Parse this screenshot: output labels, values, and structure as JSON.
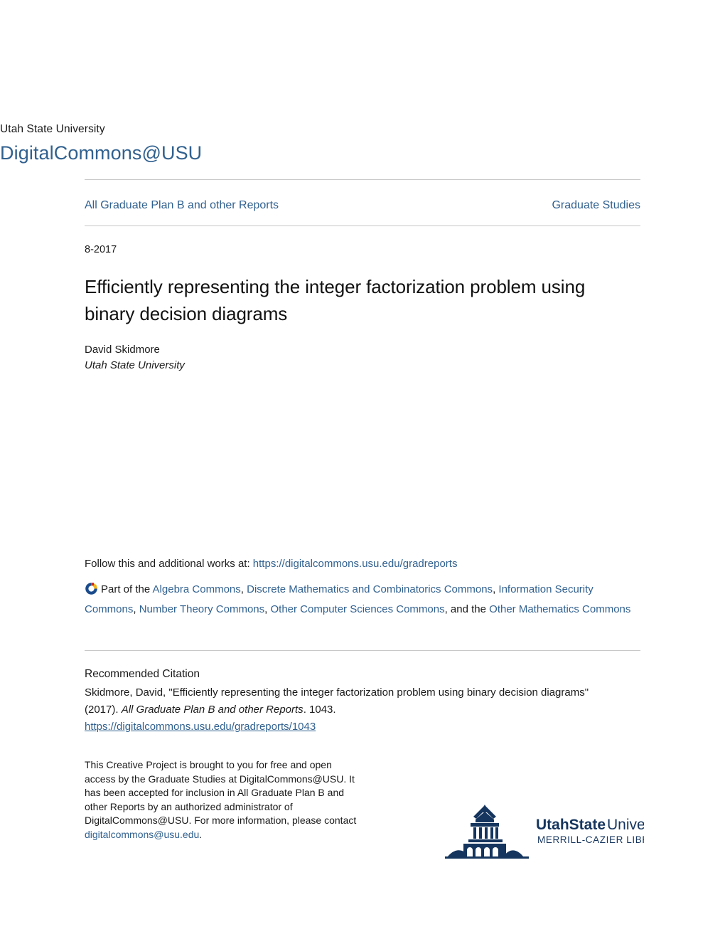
{
  "masthead": {
    "institution": "Utah State University",
    "repository": "DigitalCommons@USU"
  },
  "nav": {
    "collection": "All Graduate Plan B and other Reports",
    "department": "Graduate Studies"
  },
  "article": {
    "date": "8-2017",
    "title": "Efficiently representing the integer factorization problem using binary decision diagrams",
    "author": "David Skidmore",
    "affiliation": "Utah State University"
  },
  "follow": {
    "prefix": "Follow this and additional works at: ",
    "url": "https://digitalcommons.usu.edu/gradreports"
  },
  "disciplines": {
    "icon_name": "digital-commons-network-icon",
    "prefix": "Part of the ",
    "links": [
      "Algebra Commons",
      "Discrete Mathematics and Combinatorics Commons",
      "Information Security Commons",
      "Number Theory Commons",
      "Other Computer Sciences Commons",
      "Other Mathematics Commons"
    ],
    "separator": ", ",
    "conjunction": ", and the "
  },
  "citation": {
    "heading": "Recommended Citation",
    "text_before_italic": "Skidmore, David, \"Efficiently representing the integer factorization problem using binary decision diagrams\" (2017). ",
    "italic_part": "All Graduate Plan B and other Reports",
    "text_after_italic": ". 1043.",
    "url": "https://digitalcommons.usu.edu/gradreports/1043"
  },
  "footer_note": {
    "text": "This Creative Project is brought to you for free and open access by the Graduate Studies at DigitalCommons@USU. It has been accepted for inclusion in All Graduate Plan B and other Reports by an authorized administrator of DigitalCommons@USU. For more information, please contact ",
    "contact_email": "digitalcommons@usu.edu",
    "trailing": "."
  },
  "logo": {
    "name": "usu-merrill-cazier-library-logo",
    "line1_bold": "UtahState",
    "line1_light": "University",
    "line2": "MERRILL-CAZIER LIBRARY"
  },
  "colors": {
    "link_blue": "#31618f",
    "logo_navy": "#15355e",
    "rule_gray": "#c8c8c8",
    "text_black": "#1a1a1a"
  }
}
